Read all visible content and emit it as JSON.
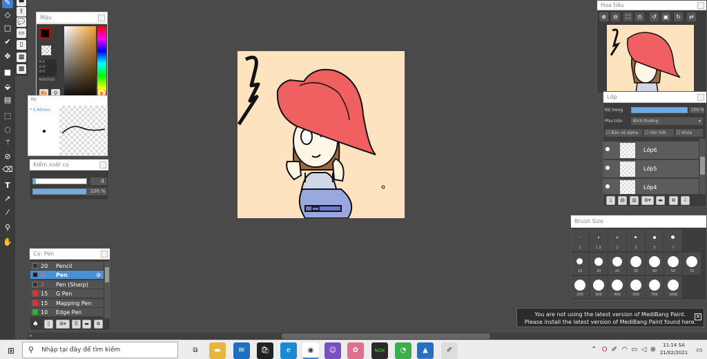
{
  "color_panel": {
    "title": "Màu",
    "r": "R:0",
    "g": "G:0",
    "b": "B:0",
    "hex": "#000000"
  },
  "brush_preview": {
    "label": "Xe",
    "size": "* 0.85mm"
  },
  "control_panel": {
    "title": "Kiểm soát cọ",
    "size_value": "4",
    "opacity_value": "100 %",
    "size_level": 0.05,
    "opacity_level": 1.0
  },
  "brush_list": {
    "title": "Cọ: Pen",
    "items": [
      {
        "size": "20",
        "name": "Pencil",
        "color": "#333333"
      },
      {
        "size": "4",
        "name": "Pen",
        "color": "#222222"
      },
      {
        "size": "2",
        "name": "Pen (Sharp)",
        "color": "#333333"
      },
      {
        "size": "15",
        "name": "G Pen",
        "color": "#e03030"
      },
      {
        "size": "15",
        "name": "Mapping Pen",
        "color": "#e03030"
      },
      {
        "size": "10",
        "name": "Edge Pen",
        "color": "#30b030"
      }
    ]
  },
  "navigator": {
    "title": "Hoa tiêu"
  },
  "layers": {
    "title": "Lớp",
    "opacity_label": "Độ trong",
    "opacity_value": "100 %",
    "opacity_level": 1.0,
    "blend_label": "Pha trộn",
    "blend_value": "Bình thường",
    "protect_alpha": "Bảo vệ alpha",
    "clipping": "Xén bớt",
    "lock": "Khóa",
    "items": [
      {
        "name": "Lớp6"
      },
      {
        "name": "Lớp5"
      },
      {
        "name": "Lớp4"
      }
    ]
  },
  "brush_size": {
    "title": "Brush Size",
    "row1": [
      "1",
      "1.5",
      "2",
      "3",
      "5",
      "7"
    ],
    "row2": [
      "15",
      "20",
      "25",
      "30",
      "40",
      "50",
      "70"
    ],
    "row3": [
      "200",
      "300",
      "400",
      "500",
      "700",
      "1000"
    ]
  },
  "notification": {
    "line1": "You are not using the latest version of MediBang Paint.",
    "line2": "Please install the latest version of MediBang Paint found here."
  },
  "taskbar": {
    "search_placeholder": "Nhập tại đây để tìm kiếm",
    "time": "11:14 SA",
    "date": "21/02/2021"
  },
  "colors": {
    "hat": "#f06060",
    "canvas_bg": "#fde3bf",
    "accent": "#3b7cd5",
    "hair": "#a0683a"
  }
}
